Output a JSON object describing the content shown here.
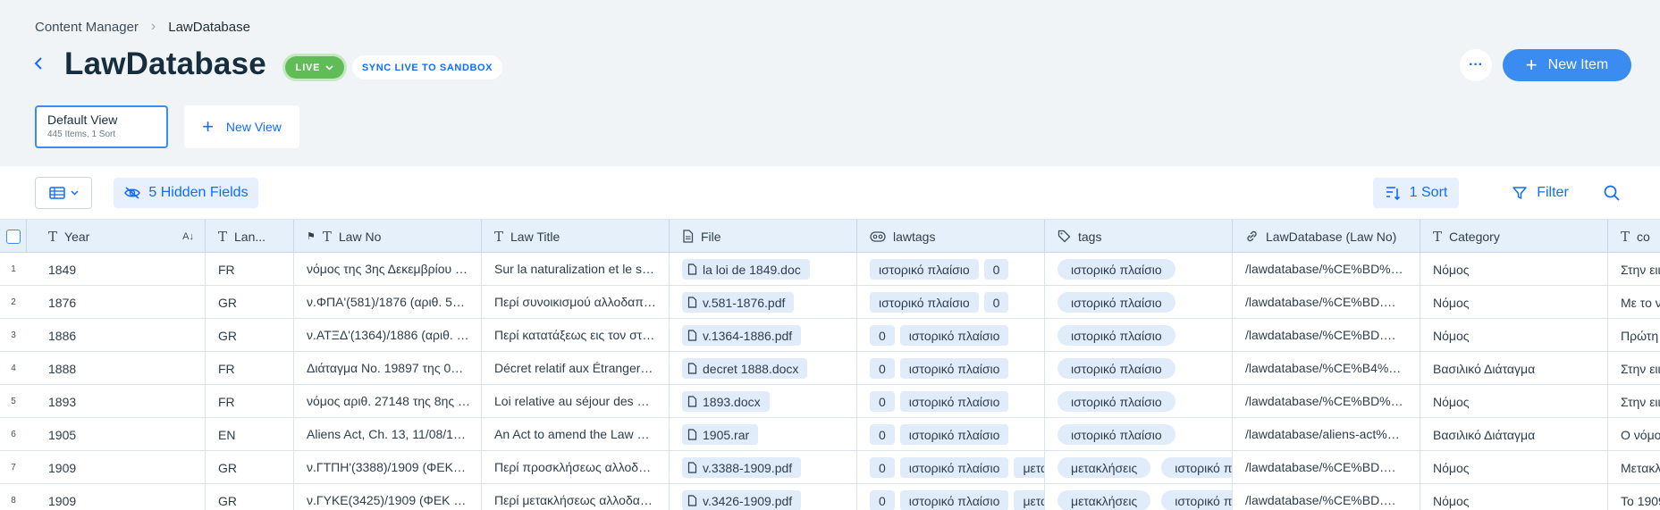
{
  "breadcrumb": {
    "root": "Content Manager",
    "current": "LawDatabase"
  },
  "header": {
    "title": "LawDatabase",
    "live_label": "LIVE",
    "sync_label": "SYNC LIVE TO SANDBOX",
    "new_item_label": "New Item"
  },
  "views": {
    "default_name": "Default View",
    "default_meta": "445 Items, 1 Sort",
    "new_view_label": "New View"
  },
  "toolbar": {
    "hidden_fields_label": "5 Hidden Fields",
    "sort_label": "1 Sort",
    "filter_label": "Filter"
  },
  "columns": {
    "year": "Year",
    "lang": "Lan...",
    "lawno": "Law No",
    "title": "Law Title",
    "file": "File",
    "lawtags": "lawtags",
    "tags": "tags",
    "link": "LawDatabase (Law No)",
    "category": "Category",
    "content": "co"
  },
  "rows": [
    {
      "n": "1",
      "year": "1849",
      "lang": "FR",
      "lawno": "νόμος της 3ης Δεκεμβρίου 1…",
      "title": "Sur la naturalization et le s…",
      "file": "la loi de 1849.doc",
      "lawtags": [
        "ιστορικό πλαίσιο",
        "0"
      ],
      "tags": [
        "ιστορικό πλαίσιο"
      ],
      "link": "/lawdatabase/%CE%BD%…",
      "category": "Νόμος",
      "content": "Στην ειι"
    },
    {
      "n": "2",
      "year": "1876",
      "lang": "GR",
      "lawno": "ν.ΦΠΑ'(581)/1876 (αριθ. 5…",
      "title": "Περί συνοικισμού αλλοδαπ…",
      "file": "v.581-1876.pdf",
      "lawtags": [
        "ιστορικό πλαίσιο",
        "0"
      ],
      "tags": [
        "ιστορικό πλαίσιο"
      ],
      "link": "/lawdatabase/%CE%BD….",
      "category": "Νόμος",
      "content": "Με το ν"
    },
    {
      "n": "3",
      "year": "1886",
      "lang": "GR",
      "lawno": "ν.ΑΤΞΔ'(1364)/1886 (αριθ. …",
      "title": "Περί κατατάξεως εις τον στρ…",
      "file": "v.1364-1886.pdf",
      "lawtags": [
        "0",
        "ιστορικό πλαίσιο"
      ],
      "tags": [
        "ιστορικό πλαίσιο"
      ],
      "link": "/lawdatabase/%CE%BD….",
      "category": "Νόμος",
      "content": "Πρώτη"
    },
    {
      "n": "4",
      "year": "1888",
      "lang": "FR",
      "lawno": "Διάταγμα No. 19897 της 02…",
      "title": "Décret relatif aux Étranger…",
      "file": "decret 1888.docx",
      "lawtags": [
        "0",
        "ιστορικό πλαίσιο"
      ],
      "tags": [
        "ιστορικό πλαίσιο"
      ],
      "link": "/lawdatabase/%CE%B4%…",
      "category": "Βασιλικό Διάταγμα",
      "content": "Στην ειι"
    },
    {
      "n": "5",
      "year": "1893",
      "lang": "FR",
      "lawno": "νόμος αριθ. 27148 της 8ης …",
      "title": "Loi relative au séjour des …",
      "file": "1893.docx",
      "lawtags": [
        "0",
        "ιστορικό πλαίσιο"
      ],
      "tags": [
        "ιστορικό πλαίσιο"
      ],
      "link": "/lawdatabase/%CE%BD%…",
      "category": "Νόμος",
      "content": "Στην ειι"
    },
    {
      "n": "6",
      "year": "1905",
      "lang": "EN",
      "lawno": "Aliens Act, Ch. 13, 11/08/1…",
      "title": "An Act to amend the Law …",
      "file": "1905.rar",
      "lawtags": [
        "0",
        "ιστορικό πλαίσιο"
      ],
      "tags": [
        "ιστορικό πλαίσιο"
      ],
      "link": "/lawdatabase/aliens-act%…",
      "category": "Βασιλικό Διάταγμα",
      "content": "Ο νόμο"
    },
    {
      "n": "7",
      "year": "1909",
      "lang": "GR",
      "lawno": "ν.ΓΤΠΗ'(3388)/1909 (ΦΕΚ…",
      "title": "Περί προσκλήσεως αλλοδα…",
      "file": "v.3388-1909.pdf",
      "lawtags": [
        "0",
        "ιστορικό πλαίσιο",
        "μετα"
      ],
      "tags": [
        "μετακλήσεις",
        "ιστορικό πλα"
      ],
      "link": "/lawdatabase/%CE%BD….",
      "category": "Νόμος",
      "content": "Μετακλ"
    },
    {
      "n": "8",
      "year": "1909",
      "lang": "GR",
      "lawno": "ν.ΓΥΚΕ(3425)/1909 (ΦΕΚ …",
      "title": "Περί μετακλήσεως αλλοδαπ…",
      "file": "v.3426-1909.pdf",
      "lawtags": [
        "0",
        "ιστορικό πλαίσιο",
        "μετα"
      ],
      "tags": [
        "μετακλήσεις",
        "ιστορικό πλα"
      ],
      "link": "/lawdatabase/%CE%BD….",
      "category": "Νόμος",
      "content": "Το 1909"
    }
  ]
}
